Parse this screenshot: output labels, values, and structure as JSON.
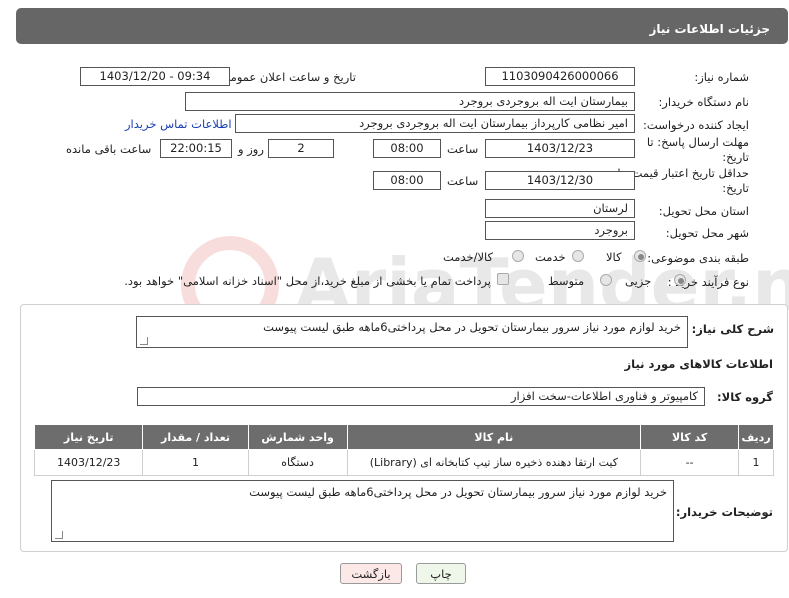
{
  "header": {
    "title": "جزئیات اطلاعات نیاز"
  },
  "fields": {
    "need_number_label": "شماره نیاز:",
    "need_number": "1103090426000066",
    "announce_label": "تاریخ و ساعت اعلان عمومی:",
    "announce_value": "1403/12/20 - 09:34",
    "buyer_org_label": "نام دستگاه خریدار:",
    "buyer_org": "بیمارستان ایت اله بروجردی بروجرد",
    "creator_label": "ایجاد کننده درخواست:",
    "creator": "امیر نظامی کارپرداز بیمارستان ایت اله بروجردی بروجرد",
    "contact_link": "اطلاعات تماس خریدار",
    "reply_deadline_label": "مهلت ارسال پاسخ: تا تاریخ:",
    "reply_date": "1403/12/23",
    "time_label": "ساعت",
    "reply_time": "08:00",
    "days_value": "2",
    "days_label": "روز و",
    "remaining_time": "22:00:15",
    "remaining_label": "ساعت باقی مانده",
    "price_deadline_label": "حداقل تاریخ اعتبار قیمت: تا تاریخ:",
    "price_date": "1403/12/30",
    "price_time": "08:00",
    "province_label": "استان محل تحویل:",
    "province": "لرستان",
    "city_label": "شهر محل تحویل:",
    "city": "بروجرد",
    "category_label": "طبقه بندی موضوعی:",
    "category_options": [
      "کالا",
      "خدمت",
      "کالا/خدمت"
    ],
    "process_label": "نوع فرآیند خرید :",
    "process_options": [
      "جزیی",
      "متوسط"
    ],
    "payment_note": "پرداخت تمام یا بخشی از مبلغ خرید،از محل \"اسناد خزانه اسلامی\" خواهد بود."
  },
  "details": {
    "desc_label": "شرح کلی نیاز:",
    "desc": "خرید لوازم مورد نیاز سرور بیمارستان تحویل در محل پرداختی6ماهه طبق لیست پیوست",
    "goods_title": "اطلاعات کالاهای مورد نیاز",
    "group_label": "گروه کالا:",
    "group": "کامپیوتر و فناوری اطلاعات-سخت افزار",
    "table": {
      "headers": [
        "ردیف",
        "کد کالا",
        "نام کالا",
        "واحد شمارش",
        "تعداد / مقدار",
        "تاریخ نیاز"
      ],
      "rows": [
        [
          "1",
          "--",
          "کیت ارتقا دهنده ذخیره ساز تیپ کتابخانه ای (Library)",
          "دستگاه",
          "1",
          "1403/12/23"
        ]
      ]
    },
    "buyer_notes_label": "توضیحات خریدار:",
    "buyer_notes": "خرید لوازم مورد نیاز سرور بیمارستان تحویل در محل پرداختی6ماهه طبق لیست پیوست"
  },
  "buttons": {
    "print": "چاپ",
    "back": "بازگشت"
  },
  "watermark": "AriaTender.net",
  "colors": {
    "header_bg": "#666666",
    "link": "#1a3fb5",
    "back_btn_bg": "#fde8e8",
    "print_btn_bg": "#eef7ea"
  }
}
